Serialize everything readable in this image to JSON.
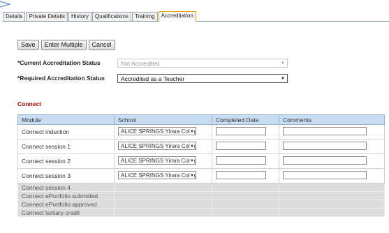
{
  "tabs": [
    "Details",
    "Private Details",
    "History",
    "Qualifications",
    "Training",
    "Accreditation"
  ],
  "toolbar": {
    "save": "Save",
    "enter_multiple": "Enter Multiple",
    "cancel": "Cancel"
  },
  "fields": {
    "current_label": "*Current Accreditation Status",
    "current_value": "Not Accredited",
    "required_label": "*Required Accreditation Status",
    "required_value": "Accredited as a Teacher"
  },
  "section": {
    "title": "Connect"
  },
  "table": {
    "headers": [
      "Module",
      "School",
      "Completed Date",
      "Comments"
    ],
    "rows": [
      {
        "module": "Connect induction",
        "school": "ALICE SPRINGS Yirara College"
      },
      {
        "module": "Connect session 1",
        "school": "ALICE SPRINGS Yirara College"
      },
      {
        "module": "Connect session 2",
        "school": "ALICE SPRINGS Yirara College"
      },
      {
        "module": "Connect session 3",
        "school": "ALICE SPRINGS Yirara College"
      }
    ],
    "inactive_rows": [
      {
        "module": "Connect session 4"
      },
      {
        "module": "Connect ePortfolio submitted"
      },
      {
        "module": "Connect ePortfolio approved"
      },
      {
        "module": "Connect tertiary credit"
      }
    ]
  },
  "icons": {
    "dropdown": "▼"
  }
}
